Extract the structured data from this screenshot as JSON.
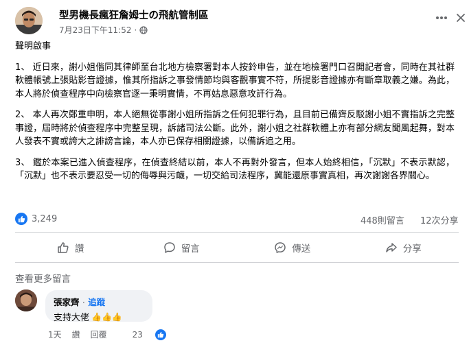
{
  "header": {
    "page_name": "型男機長瘋狂詹姆士の飛航管制區",
    "timestamp": "7月23日下午11:52",
    "separator": "·"
  },
  "post": {
    "title": "聲明啟事",
    "paragraphs": [
      "1、 近日來，謝小姐偕同其律師至台北地方檢察署對本人按鈴申告，並在地檢署門口召開記者會，同時在其社群軟體帳號上張貼影音證據，惟其所指訴之事發情節均與客觀事實不符，所提影音證據亦有斷章取義之嫌。為此，本人將於偵查程序中向檢察官逐一秉明實情，不再姑息惡意攻訐行為。",
      "2、 本人再次鄭重申明，本人絕無從事謝小姐所指訴之任何犯罪行為，且目前已備齊反駁謝小姐不實指訴之完整事證，屆時將於偵查程序中完整呈現，訴諸司法公斷。此外，謝小姐之社群軟體上亦有部分網友聞風起舞，對本人發表不實或誇大之誹謗言論，本人亦已保存相關證據，以備訴追之用。",
      "3、 鑑於本案已進入偵查程序，在偵查終結以前，本人不再對外發言，但本人始終相信，「沉默」不表示默認，「沉默」也不表示要忍受一切的侮辱與污衊，一切交給司法程序，冀能還原事實真相，再次謝謝各界關心。"
    ]
  },
  "stats": {
    "likes": "3,249",
    "comments": "448則留言",
    "shares": "12次分享"
  },
  "actions": {
    "like": "讚",
    "comment": "留言",
    "send": "傳送",
    "share": "分享"
  },
  "comments_section": {
    "view_more": "查看更多留言",
    "items": [
      {
        "author": "張家齊",
        "separator": "·",
        "follow": "追蹤",
        "text": "支持大佬",
        "emoji": "👍👍👍",
        "time": "1天",
        "like": "讚",
        "reply": "回覆",
        "reaction_count": "23"
      }
    ]
  },
  "colors": {
    "accent": "#1877f2",
    "secondary_text": "#65676b",
    "divider": "#ced0d4",
    "bubble": "#f0f2f5"
  }
}
